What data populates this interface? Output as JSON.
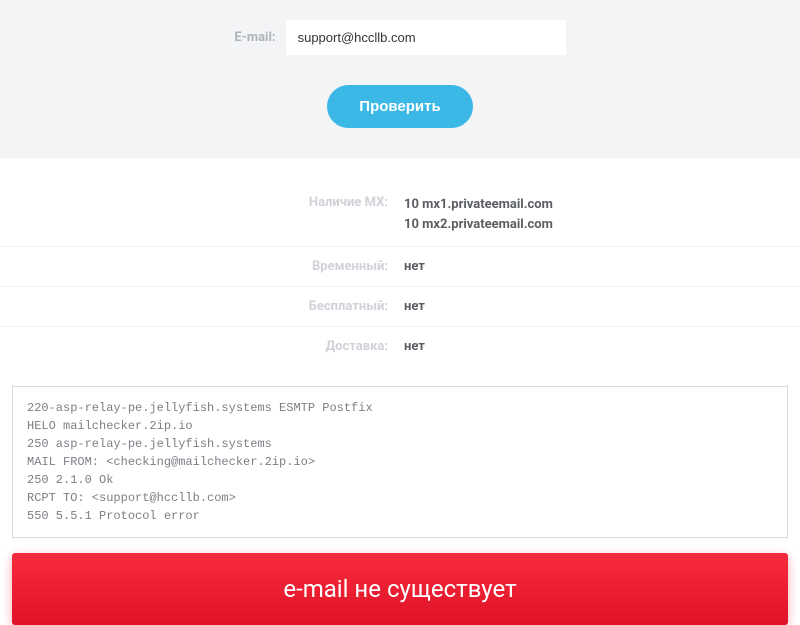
{
  "form": {
    "email_label": "E-mail:",
    "email_value": "support@hccllb.com",
    "check_button": "Проверить"
  },
  "results": {
    "mx_label": "Наличие MX:",
    "mx_records": [
      "10 mx1.privateemail.com",
      "10 mx2.privateemail.com"
    ],
    "temporary_label": "Временный:",
    "temporary_value": "нет",
    "free_label": "Бесплатный:",
    "free_value": "нет",
    "delivery_label": "Доставка:",
    "delivery_value": "нет"
  },
  "smtp_log": "220-asp-relay-pe.jellyfish.systems ESMTP Postfix\nHELO mailchecker.2ip.io\n250 asp-relay-pe.jellyfish.systems\nMAIL FROM: <checking@mailchecker.2ip.io>\n250 2.1.0 Ok\nRCPT TO: <support@hccllb.com>\n550 5.5.1 Protocol error",
  "status_message": "e-mail не существует"
}
